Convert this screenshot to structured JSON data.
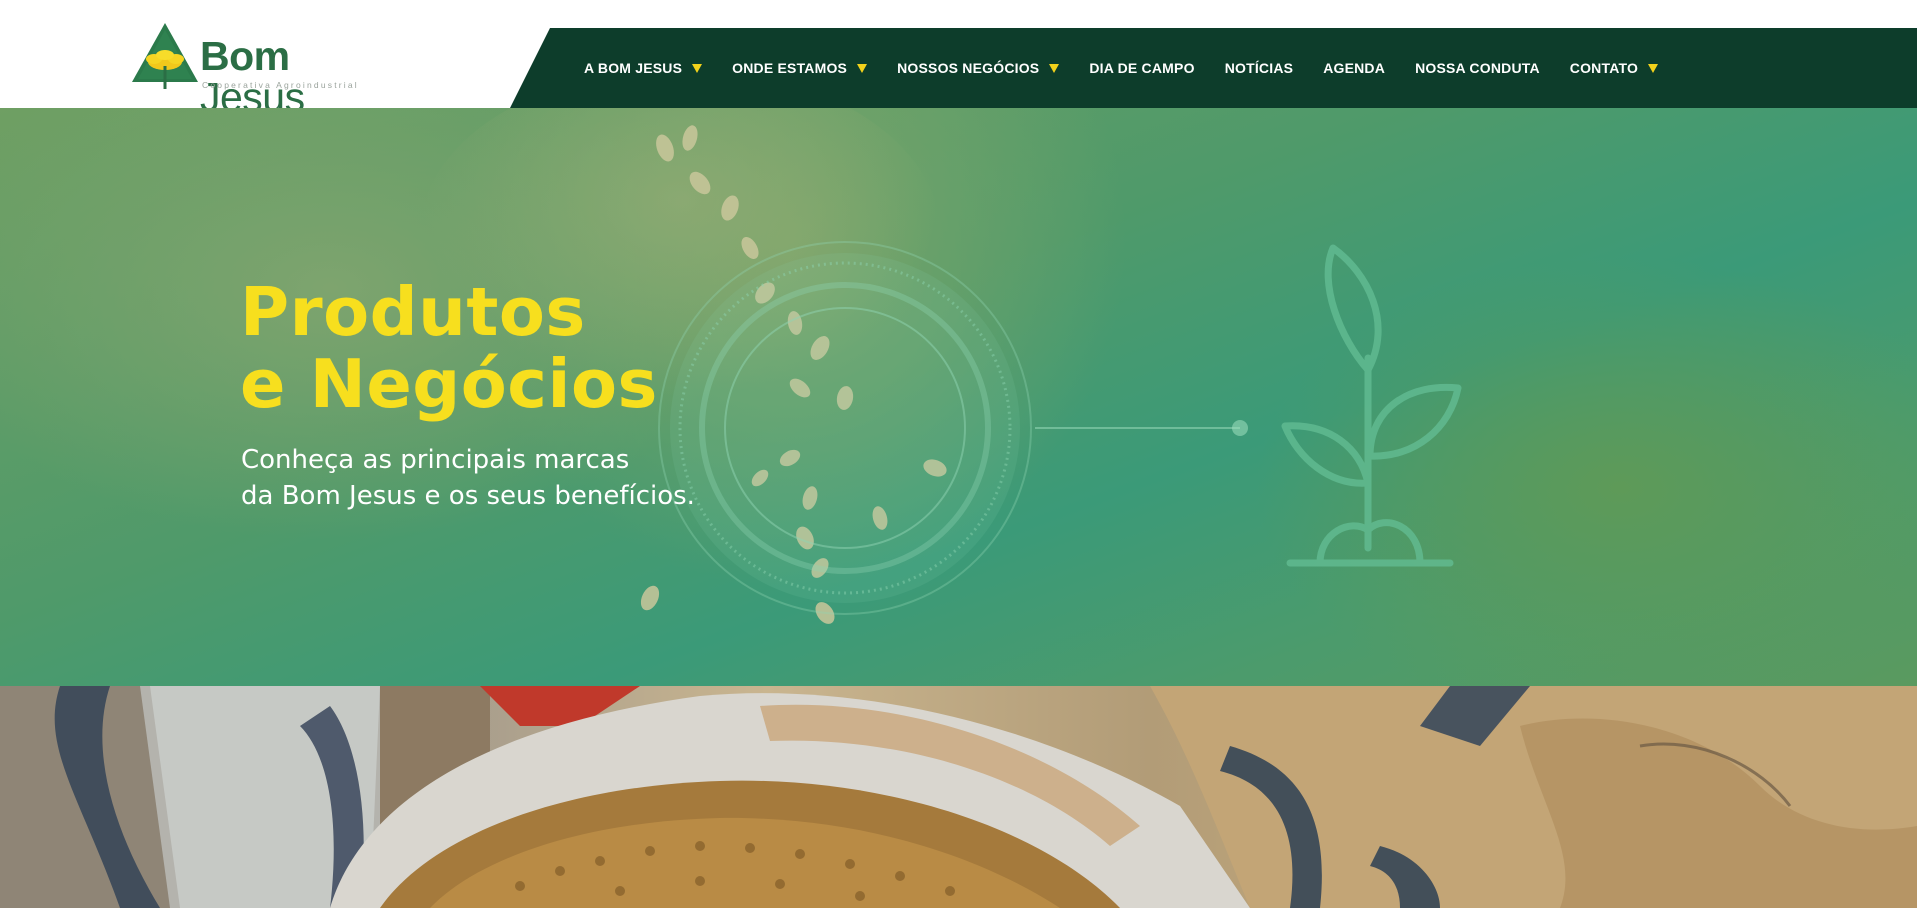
{
  "brand": {
    "name_part1": "Bom",
    "name_part2": "Jesus",
    "tagline": "Cooperativa Agroindustrial",
    "primary_color": "#2b6e45",
    "accent_color": "#f7df1e",
    "nav_background": "#0d3d2b"
  },
  "nav": {
    "items": [
      {
        "label": "A BOM JESUS",
        "dropdown": true
      },
      {
        "label": "ONDE ESTAMOS",
        "dropdown": true
      },
      {
        "label": "NOSSOS NEGÓCIOS",
        "dropdown": true
      },
      {
        "label": "DIA DE CAMPO",
        "dropdown": false
      },
      {
        "label": "NOTÍCIAS",
        "dropdown": false
      },
      {
        "label": "AGENDA",
        "dropdown": false
      },
      {
        "label": "NOSSA CONDUTA",
        "dropdown": false
      },
      {
        "label": "CONTATO",
        "dropdown": true
      }
    ]
  },
  "hero": {
    "title_line1": "Produtos",
    "title_line2": "e Negócios",
    "subtitle_line1": "Conheça as principais marcas",
    "subtitle_line2": "da Bom Jesus e os seus benefícios.",
    "icon": "plant-sprout-icon"
  }
}
